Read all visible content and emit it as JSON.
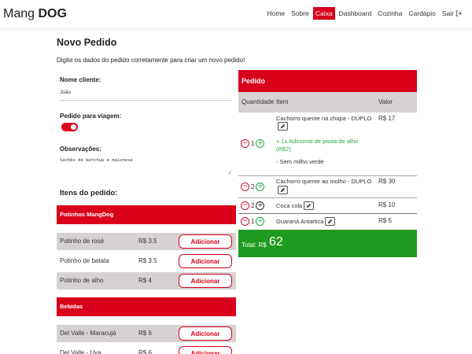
{
  "navbar": {
    "brand_regular": "Mang",
    "brand_bold": "DOG",
    "items": [
      {
        "label": "Home",
        "active": false
      },
      {
        "label": "Sobre",
        "active": false
      },
      {
        "label": "Caixa",
        "active": true
      },
      {
        "label": "Dashboard",
        "active": false
      },
      {
        "label": "Cozinha",
        "active": false
      },
      {
        "label": "Cardápio",
        "active": false
      },
      {
        "label": "Sair",
        "active": false
      }
    ]
  },
  "form": {
    "title": "Novo Pedido",
    "subtitle": "Digite os dados do pedido corretamente para criar um novo pedido!",
    "customer_label": "Nome cliente:",
    "customer_value": "João",
    "takeaway_label": "Pedido para viagem:",
    "takeaway_checked": true,
    "notes_label": "Observações:",
    "notes_value": "Sachês de ketchup e maionese"
  },
  "items_section": {
    "title": "Itens do pedido:",
    "categories": [
      {
        "name": "Potinhos MangDog",
        "products": [
          {
            "name": "Potinho de rosé",
            "price": "R$ 3.5",
            "button": "Adicionar"
          },
          {
            "name": "Potinho de batata",
            "price": "R$ 3.5",
            "button": "Adicionar"
          },
          {
            "name": "Potinho de alho",
            "price": "R$ 4",
            "button": "Adicionar"
          }
        ]
      },
      {
        "name": "Bebidas",
        "products": [
          {
            "name": "Del Valle - Maracujá",
            "price": "R$ 6",
            "button": "Adicionar"
          },
          {
            "name": "Del Valle - Uva",
            "price": "R$ 6",
            "button": "Adicionar"
          }
        ]
      }
    ]
  },
  "order": {
    "header": "Pedido",
    "col_quantity": "Quantidade",
    "col_item": "Item",
    "col_value": "Valor",
    "items": [
      {
        "qty": "1",
        "name": "Cachorro quente na chapa - DUPLO",
        "extra": "+ 1x Adicional de pasta de alho (R$2)",
        "note": "- Sem milho verde",
        "price": "R$ 17"
      },
      {
        "qty": "2",
        "name": "Cachorro quente ao molho - DUPLO",
        "price": "R$ 30"
      },
      {
        "qty": "2",
        "name": "Coca cola",
        "price": "R$ 10"
      },
      {
        "qty": "1",
        "name": "Guaraná Antartica",
        "price": "R$ 5"
      }
    ],
    "total_label": "Total: R$",
    "total_value": "62"
  },
  "colors": {
    "primary_red": "#d9001b",
    "total_green": "#1e9b1e",
    "row_gray": "#d6d2d2"
  },
  "icons": [
    "logout-icon",
    "edit-icon",
    "minus-circle-icon",
    "plus-circle-icon",
    "toggle-switch"
  ]
}
